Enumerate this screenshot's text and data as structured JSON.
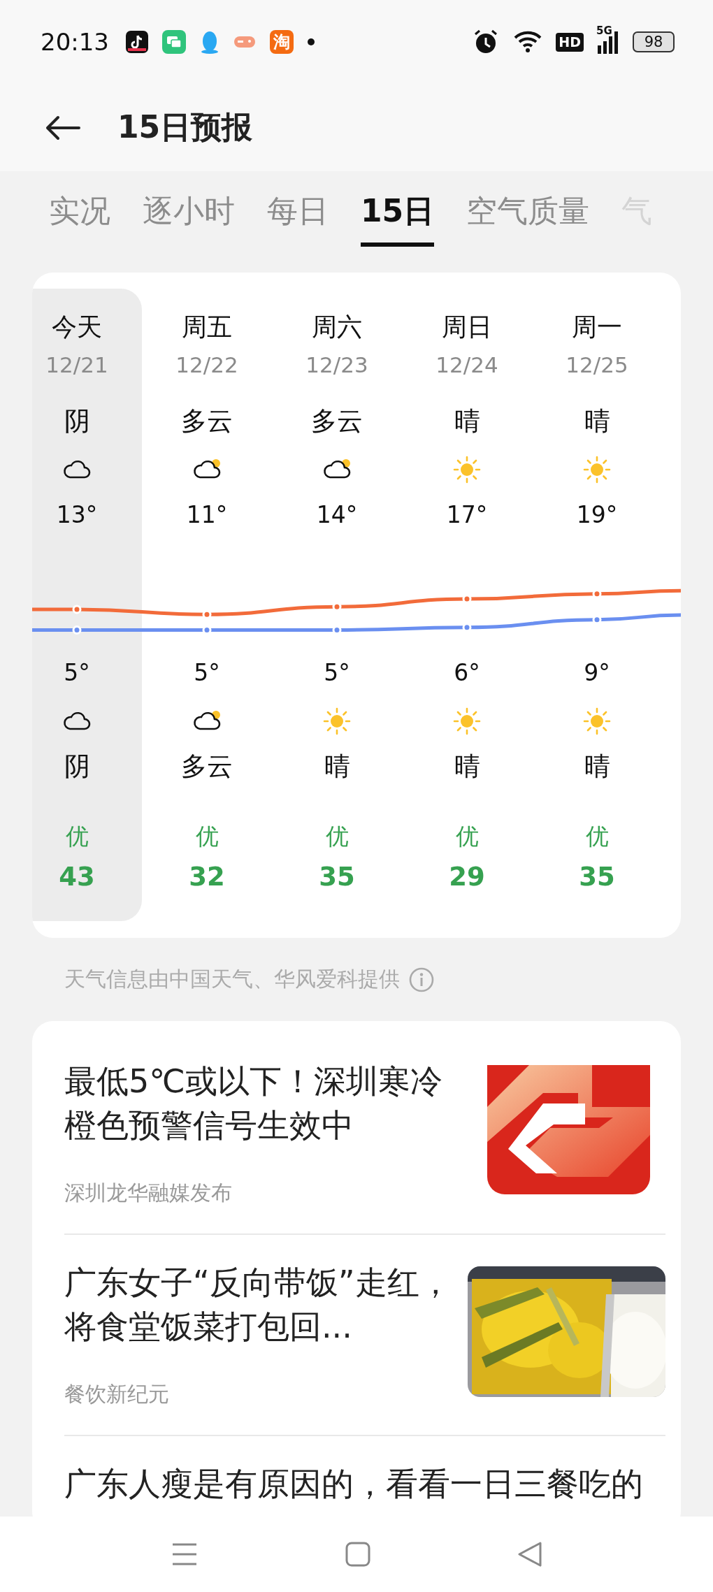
{
  "status_bar": {
    "time": "20:13",
    "shop_app_char": "淘",
    "hd_label": "HD",
    "network_label": "5G",
    "battery": "98"
  },
  "header": {
    "title": "15日预报"
  },
  "tabs": [
    {
      "label": "实况",
      "selected": false
    },
    {
      "label": "逐小时",
      "selected": false
    },
    {
      "label": "每日",
      "selected": false
    },
    {
      "label": "15日",
      "selected": true
    },
    {
      "label": "空气质量",
      "selected": false
    },
    {
      "label": "气",
      "selected": false
    }
  ],
  "forecast": {
    "days": [
      {
        "day": "今天",
        "date": "12/21",
        "selected": true,
        "high_cond": "阴",
        "high_icon": {
          "kind": "cloudy"
        },
        "high": "13°",
        "low": "5°",
        "low_icon": {
          "kind": "cloudy"
        },
        "low_cond": "阴",
        "aqi_level": "优",
        "aqi": "43"
      },
      {
        "day": "周五",
        "date": "12/22",
        "selected": false,
        "high_cond": "多云",
        "high_icon": {
          "kind": "partly_cloudy"
        },
        "high": "11°",
        "low": "5°",
        "low_icon": {
          "kind": "partly_cloudy"
        },
        "low_cond": "多云",
        "aqi_level": "优",
        "aqi": "32"
      },
      {
        "day": "周六",
        "date": "12/23",
        "selected": false,
        "high_cond": "多云",
        "high_icon": {
          "kind": "partly_cloudy"
        },
        "high": "14°",
        "low": "5°",
        "low_icon": {
          "kind": "sunny"
        },
        "low_cond": "晴",
        "aqi_level": "优",
        "aqi": "35"
      },
      {
        "day": "周日",
        "date": "12/24",
        "selected": false,
        "high_cond": "晴",
        "high_icon": {
          "kind": "sunny"
        },
        "high": "17°",
        "low": "6°",
        "low_icon": {
          "kind": "sunny"
        },
        "low_cond": "晴",
        "aqi_level": "优",
        "aqi": "29"
      },
      {
        "day": "周一",
        "date": "12/25",
        "selected": false,
        "high_cond": "晴",
        "high_icon": {
          "kind": "sunny"
        },
        "high": "19°",
        "low": "9°",
        "low_icon": {
          "kind": "sunny"
        },
        "low_cond": "晴",
        "aqi_level": "优",
        "aqi": "35"
      }
    ]
  },
  "source_note": "天气信息由中国天气、华风爱科提供",
  "news": [
    {
      "title": "最低5℃或以下！深圳寒冷橙色预警信号生效中",
      "source": "深圳龙华融媒发布",
      "thumb": {
        "kind": "logo"
      }
    },
    {
      "title": "广东女子“反向带饭”走红，将食堂饭菜打包回...",
      "source": "餐饮新纪元"
    },
    {
      "title": "广东人瘦是有原因的，看看一日三餐吃的"
    }
  ]
}
